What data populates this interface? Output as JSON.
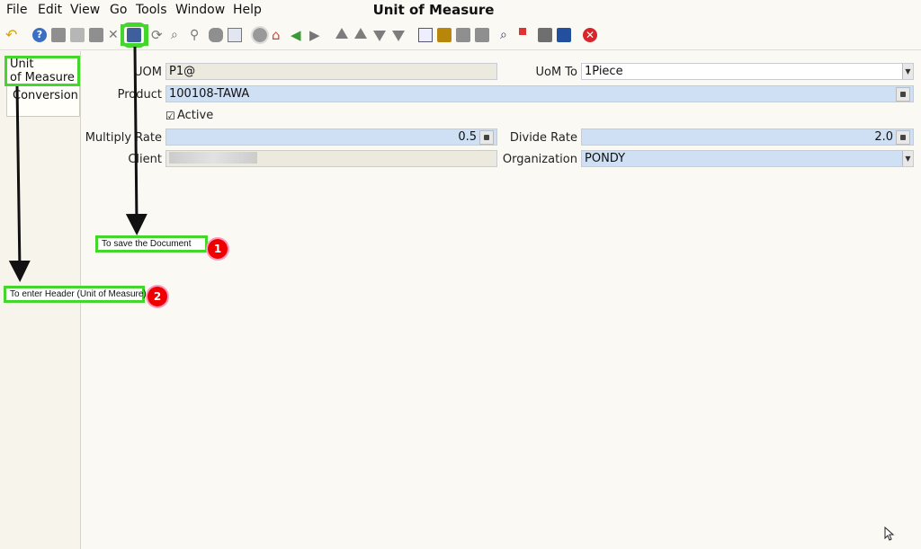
{
  "window": {
    "title": "Unit of Measure"
  },
  "menu": [
    "File",
    "Edit",
    "View",
    "Go",
    "Tools",
    "Window",
    "Help"
  ],
  "tabs": {
    "header": "Unit\nof Measure",
    "header_line1": "Unit",
    "header_line2": "of Measure",
    "detail": "Conversion"
  },
  "form": {
    "uom_label": "UOM",
    "uom_value": "P1@",
    "uom_to_label": "UoM To",
    "uom_to_value": "1Piece",
    "product_label": "Product",
    "product_value": "100108-TAWA",
    "active_label": "Active",
    "multiply_label": "Multiply Rate",
    "multiply_value": "0.5",
    "divide_label": "Divide Rate",
    "divide_value": "2.0",
    "client_label": "Client",
    "client_value": "",
    "org_label": "Organization",
    "org_value": "PONDY"
  },
  "annotations": {
    "save_note": "To save the Document",
    "save_badge": "1",
    "header_note": "To enter Header (Unit of Measure)",
    "header_badge": "2"
  },
  "colors": {
    "highlight": "#44d62c",
    "badge": "#e00000",
    "required_field": "#cfe0f5"
  }
}
